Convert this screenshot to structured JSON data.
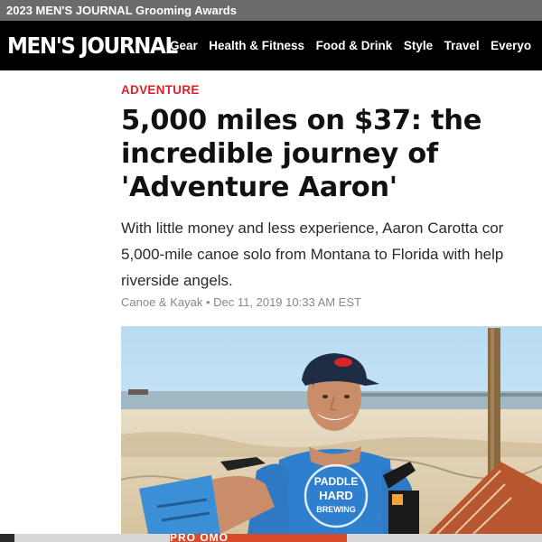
{
  "promo": {
    "text": "2023 MEN'S JOURNAL Grooming Awards"
  },
  "header": {
    "logo": "MEN'S JOURNAL",
    "nav": [
      "Gear",
      "Health & Fitness",
      "Food & Drink",
      "Style",
      "Travel",
      "Everyo"
    ]
  },
  "article": {
    "category": "ADVENTURE",
    "headline": "5,000 miles on $37: the incredible journey of 'Adventure Aaron'",
    "dek_lines": [
      "With little money and less experience, Aaron Carotta cor",
      "5,000-mile canoe solo from Montana to Florida with help",
      "riverside angels."
    ],
    "byline": {
      "author": "Canoe & Kayak",
      "separator": "•",
      "date": "Dec 11, 2019 10:33 AM EST"
    },
    "hero_image": {
      "alt": "Smiling man in blue shirt and cap with paddle on beach",
      "shirt_text": [
        "PADDLE",
        "HARD",
        "BREWING"
      ]
    }
  },
  "ad": {
    "text": "PRO   OMO"
  },
  "colors": {
    "accent": "#d9222a",
    "nav_bg": "#000000",
    "promo_bg": "#6b6b6b"
  }
}
